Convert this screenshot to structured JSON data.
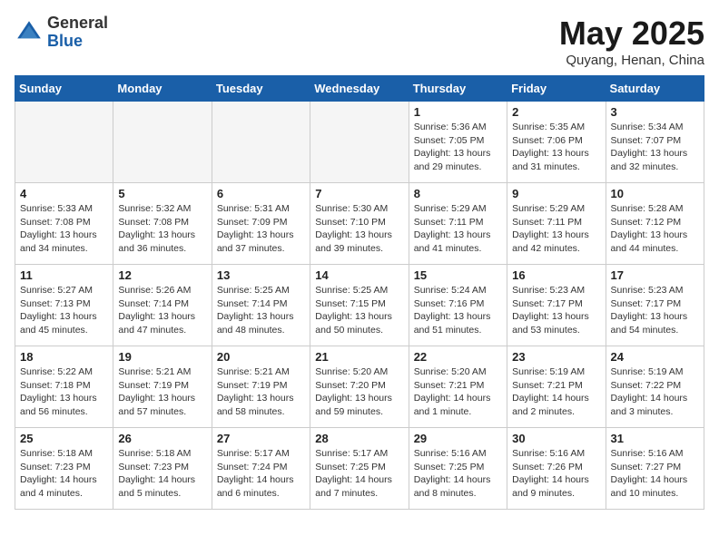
{
  "header": {
    "logo_line1": "General",
    "logo_line2": "Blue",
    "month_title": "May 2025",
    "subtitle": "Quyang, Henan, China"
  },
  "days_of_week": [
    "Sunday",
    "Monday",
    "Tuesday",
    "Wednesday",
    "Thursday",
    "Friday",
    "Saturday"
  ],
  "weeks": [
    [
      {
        "day": "",
        "empty": true
      },
      {
        "day": "",
        "empty": true
      },
      {
        "day": "",
        "empty": true
      },
      {
        "day": "",
        "empty": true
      },
      {
        "day": "1",
        "sunrise": "5:36 AM",
        "sunset": "7:05 PM",
        "daylight": "13 hours and 29 minutes."
      },
      {
        "day": "2",
        "sunrise": "5:35 AM",
        "sunset": "7:06 PM",
        "daylight": "13 hours and 31 minutes."
      },
      {
        "day": "3",
        "sunrise": "5:34 AM",
        "sunset": "7:07 PM",
        "daylight": "13 hours and 32 minutes."
      }
    ],
    [
      {
        "day": "4",
        "sunrise": "5:33 AM",
        "sunset": "7:08 PM",
        "daylight": "13 hours and 34 minutes."
      },
      {
        "day": "5",
        "sunrise": "5:32 AM",
        "sunset": "7:08 PM",
        "daylight": "13 hours and 36 minutes."
      },
      {
        "day": "6",
        "sunrise": "5:31 AM",
        "sunset": "7:09 PM",
        "daylight": "13 hours and 37 minutes."
      },
      {
        "day": "7",
        "sunrise": "5:30 AM",
        "sunset": "7:10 PM",
        "daylight": "13 hours and 39 minutes."
      },
      {
        "day": "8",
        "sunrise": "5:29 AM",
        "sunset": "7:11 PM",
        "daylight": "13 hours and 41 minutes."
      },
      {
        "day": "9",
        "sunrise": "5:29 AM",
        "sunset": "7:11 PM",
        "daylight": "13 hours and 42 minutes."
      },
      {
        "day": "10",
        "sunrise": "5:28 AM",
        "sunset": "7:12 PM",
        "daylight": "13 hours and 44 minutes."
      }
    ],
    [
      {
        "day": "11",
        "sunrise": "5:27 AM",
        "sunset": "7:13 PM",
        "daylight": "13 hours and 45 minutes."
      },
      {
        "day": "12",
        "sunrise": "5:26 AM",
        "sunset": "7:14 PM",
        "daylight": "13 hours and 47 minutes."
      },
      {
        "day": "13",
        "sunrise": "5:25 AM",
        "sunset": "7:14 PM",
        "daylight": "13 hours and 48 minutes."
      },
      {
        "day": "14",
        "sunrise": "5:25 AM",
        "sunset": "7:15 PM",
        "daylight": "13 hours and 50 minutes."
      },
      {
        "day": "15",
        "sunrise": "5:24 AM",
        "sunset": "7:16 PM",
        "daylight": "13 hours and 51 minutes."
      },
      {
        "day": "16",
        "sunrise": "5:23 AM",
        "sunset": "7:17 PM",
        "daylight": "13 hours and 53 minutes."
      },
      {
        "day": "17",
        "sunrise": "5:23 AM",
        "sunset": "7:17 PM",
        "daylight": "13 hours and 54 minutes."
      }
    ],
    [
      {
        "day": "18",
        "sunrise": "5:22 AM",
        "sunset": "7:18 PM",
        "daylight": "13 hours and 56 minutes."
      },
      {
        "day": "19",
        "sunrise": "5:21 AM",
        "sunset": "7:19 PM",
        "daylight": "13 hours and 57 minutes."
      },
      {
        "day": "20",
        "sunrise": "5:21 AM",
        "sunset": "7:19 PM",
        "daylight": "13 hours and 58 minutes."
      },
      {
        "day": "21",
        "sunrise": "5:20 AM",
        "sunset": "7:20 PM",
        "daylight": "13 hours and 59 minutes."
      },
      {
        "day": "22",
        "sunrise": "5:20 AM",
        "sunset": "7:21 PM",
        "daylight": "14 hours and 1 minute."
      },
      {
        "day": "23",
        "sunrise": "5:19 AM",
        "sunset": "7:21 PM",
        "daylight": "14 hours and 2 minutes."
      },
      {
        "day": "24",
        "sunrise": "5:19 AM",
        "sunset": "7:22 PM",
        "daylight": "14 hours and 3 minutes."
      }
    ],
    [
      {
        "day": "25",
        "sunrise": "5:18 AM",
        "sunset": "7:23 PM",
        "daylight": "14 hours and 4 minutes."
      },
      {
        "day": "26",
        "sunrise": "5:18 AM",
        "sunset": "7:23 PM",
        "daylight": "14 hours and 5 minutes."
      },
      {
        "day": "27",
        "sunrise": "5:17 AM",
        "sunset": "7:24 PM",
        "daylight": "14 hours and 6 minutes."
      },
      {
        "day": "28",
        "sunrise": "5:17 AM",
        "sunset": "7:25 PM",
        "daylight": "14 hours and 7 minutes."
      },
      {
        "day": "29",
        "sunrise": "5:16 AM",
        "sunset": "7:25 PM",
        "daylight": "14 hours and 8 minutes."
      },
      {
        "day": "30",
        "sunrise": "5:16 AM",
        "sunset": "7:26 PM",
        "daylight": "14 hours and 9 minutes."
      },
      {
        "day": "31",
        "sunrise": "5:16 AM",
        "sunset": "7:27 PM",
        "daylight": "14 hours and 10 minutes."
      }
    ]
  ]
}
